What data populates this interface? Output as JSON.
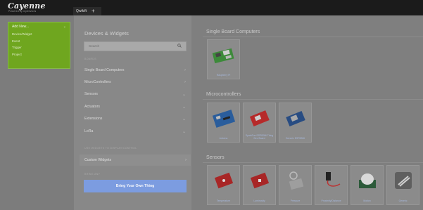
{
  "app": {
    "logo_text": "Cayenne",
    "logo_sub": "Powered by myDevices"
  },
  "tabs": [
    {
      "label": "Qwikift"
    }
  ],
  "add_menu": {
    "header": "Add New...",
    "items": [
      "Device/Widget",
      "Event",
      "Trigger",
      "Project"
    ]
  },
  "devices_widgets": {
    "title": "Devices & Widgets",
    "search_placeholder": "Search",
    "caption_boards": "BOARDS",
    "categories": [
      "Single Board Computers",
      "MicroControllers",
      "Sensors",
      "Actuators",
      "Extensions",
      "LoRa"
    ],
    "caption_custom": "USE WIDGETS TO DISPLAY/CONTROL",
    "custom_widgets": "Custom Widgets",
    "caption_byot": "BRING ANY",
    "byot_button": "Bring Your Own Thing"
  },
  "sections": {
    "sbc": {
      "title": "Single Board Computers",
      "items": [
        "Raspberry Pi"
      ]
    },
    "micro": {
      "title": "Microcontrollers",
      "items": [
        "Arduino",
        "SparkFun ESP8266 Thing Dev Board",
        "Generic ESP8266"
      ]
    },
    "sensors": {
      "title": "Sensors",
      "items": [
        "Temperature",
        "Luminosity",
        "Pressure",
        "Proximity/Distance",
        "Motion",
        "Generic"
      ]
    }
  },
  "colors": {
    "topbar": "#1b1b1b",
    "addnew_green": "#6fa61f",
    "byot_blue": "#7c9ce0"
  }
}
